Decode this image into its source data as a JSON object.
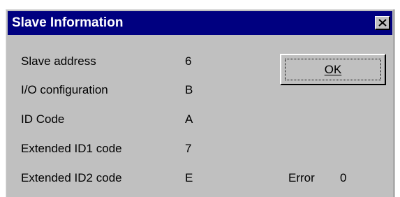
{
  "window": {
    "title": "Slave Information",
    "close_glyph": "✕"
  },
  "fields": [
    {
      "label": "Slave address",
      "value": "6"
    },
    {
      "label": "I/O configuration",
      "value": "B"
    },
    {
      "label": "ID Code",
      "value": "A"
    },
    {
      "label": "Extended ID1 code",
      "value": "7"
    },
    {
      "label": "Extended ID2 code",
      "value": "E"
    }
  ],
  "buttons": {
    "ok_label": "OK"
  },
  "status": {
    "error_label": "Error",
    "error_value": "0"
  },
  "colors": {
    "titlebar": "#000080",
    "face": "#c0c0c0"
  }
}
